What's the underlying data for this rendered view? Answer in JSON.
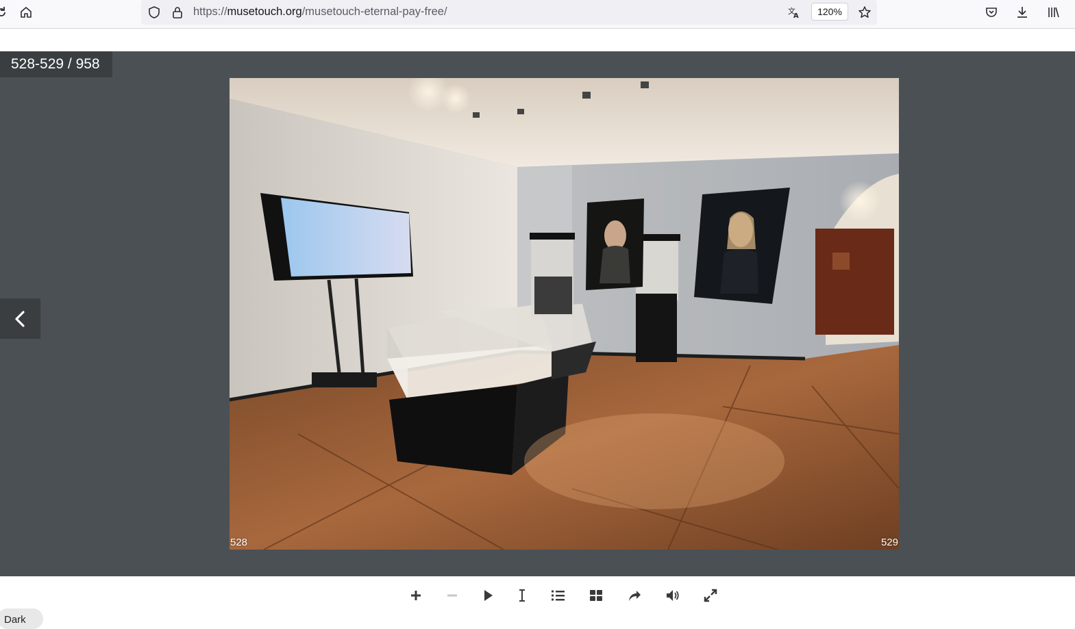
{
  "browser": {
    "url_prefix": "https://",
    "url_domain": "musetouch.org",
    "url_path": "/musetouch-eternal-pay-free/",
    "zoom": "120%",
    "icons": [
      "reload-icon",
      "home-icon",
      "shield-icon",
      "lock-icon",
      "translate-icon",
      "star-icon",
      "pocket-icon",
      "download-icon",
      "library-icon"
    ]
  },
  "viewer": {
    "page_counter": "528-529 / 958",
    "left_page_number": "528",
    "right_page_number": "529",
    "image_description_icon": "photo"
  },
  "controls": {
    "items": [
      "zoom-in-icon",
      "zoom-out-icon",
      "play-icon",
      "text-cursor-icon",
      "list-icon",
      "grid-icon",
      "share-icon",
      "sound-icon",
      "fullscreen-icon"
    ]
  },
  "theme_toggle": "Dark",
  "colors": {
    "viewer_bg": "#4b5054",
    "overlay_bg": "#3a3e41",
    "toolbar_bg": "#f9f9fb"
  }
}
